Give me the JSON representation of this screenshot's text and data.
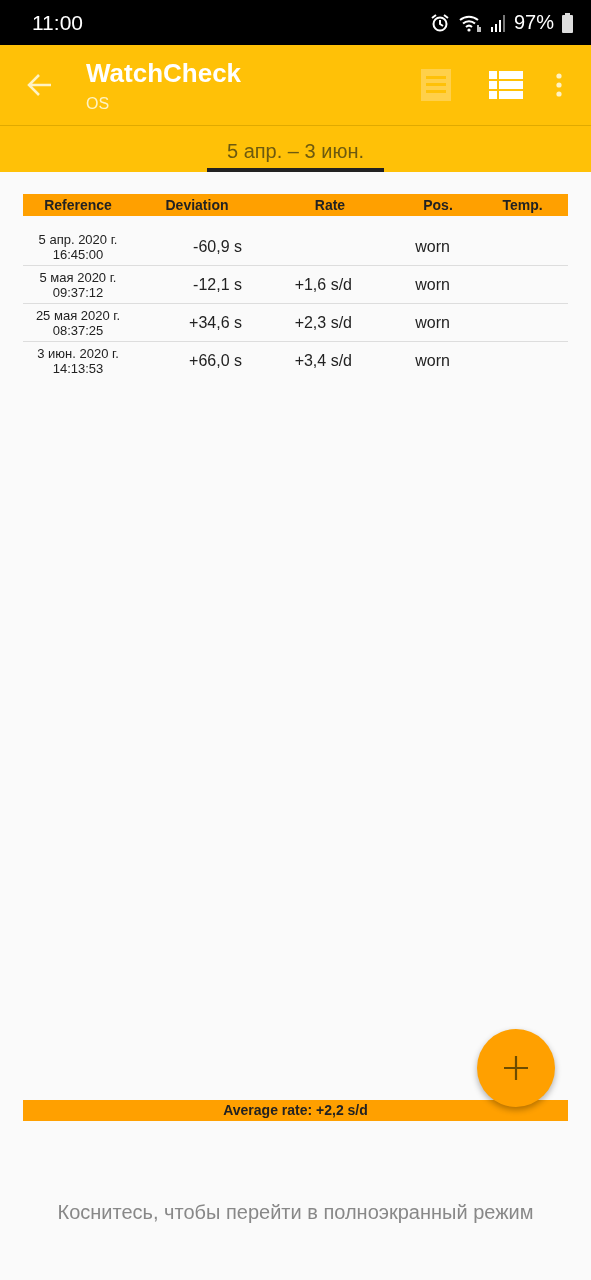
{
  "status_bar": {
    "time": "11:00",
    "battery": "97%"
  },
  "toolbar": {
    "title": "WatchCheck",
    "subtitle": "OS"
  },
  "tabs": [
    {
      "label": "5 апр. – 3 июн.",
      "selected": true
    }
  ],
  "table": {
    "columns": [
      "Reference",
      "Deviation",
      "Rate",
      "Pos.",
      "Temp."
    ],
    "rows": [
      {
        "reference": [
          "5 апр. 2020 г.",
          "16:45:00"
        ],
        "deviation": "-60,9 s",
        "position": "worn"
      },
      {
        "reference": [
          "5 мая 2020 г.",
          "09:37:12"
        ],
        "deviation": "-12,1 s",
        "rate": "+1,6 s/d",
        "position": "worn"
      },
      {
        "reference": [
          "25 мая 2020 г.",
          "08:37:25"
        ],
        "deviation": "+34,6 s",
        "rate": "+2,3 s/d",
        "position": "worn"
      },
      {
        "reference": [
          "3 июн. 2020 г.",
          "14:13:53"
        ],
        "deviation": "+66,0 s",
        "rate": "+3,4 s/d",
        "position": "worn"
      }
    ]
  },
  "average": "Average rate: +2,2 s/d",
  "hint": "Коснитесь, чтобы перейти в полноэкранный режим"
}
